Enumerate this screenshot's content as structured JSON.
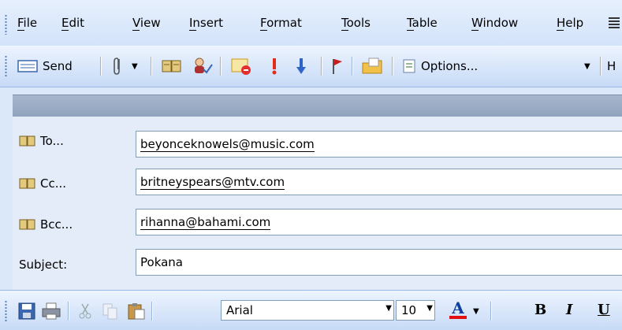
{
  "menu": {
    "items": [
      "File",
      "Edit",
      "View",
      "Insert",
      "Format",
      "Tools",
      "Table",
      "Window",
      "Help"
    ]
  },
  "toolbar": {
    "send_label": "Send",
    "options_label": "Options...",
    "trailing_label": "H"
  },
  "fields": {
    "to_label": "To...",
    "to_value": "beyonceknowels@music.com",
    "cc_label": "Cc...",
    "cc_value": "britneyspears@mtv.com",
    "bcc_label": "Bcc...",
    "bcc_value": "rihanna@bahami.com",
    "subject_label": "Subject:",
    "subject_value": "Pokana"
  },
  "format_bar": {
    "font_name": "Arial",
    "font_size": "10",
    "font_color_letter": "A",
    "bold": "B",
    "italic": "I",
    "underline": "U"
  },
  "colors": {
    "accent": "#0f3f9b",
    "font_color_bar": "#e11111",
    "header_band": "#96a7c1"
  },
  "icons": [
    "grip-icon",
    "send-envelope-icon",
    "attach-paperclip-icon",
    "address-book-icon",
    "check-names-icon",
    "signature-icon",
    "importance-high-icon",
    "importance-low-icon",
    "flag-icon",
    "folder-icon",
    "options-icon",
    "save-icon",
    "print-icon",
    "cut-icon",
    "copy-icon",
    "paste-icon"
  ]
}
